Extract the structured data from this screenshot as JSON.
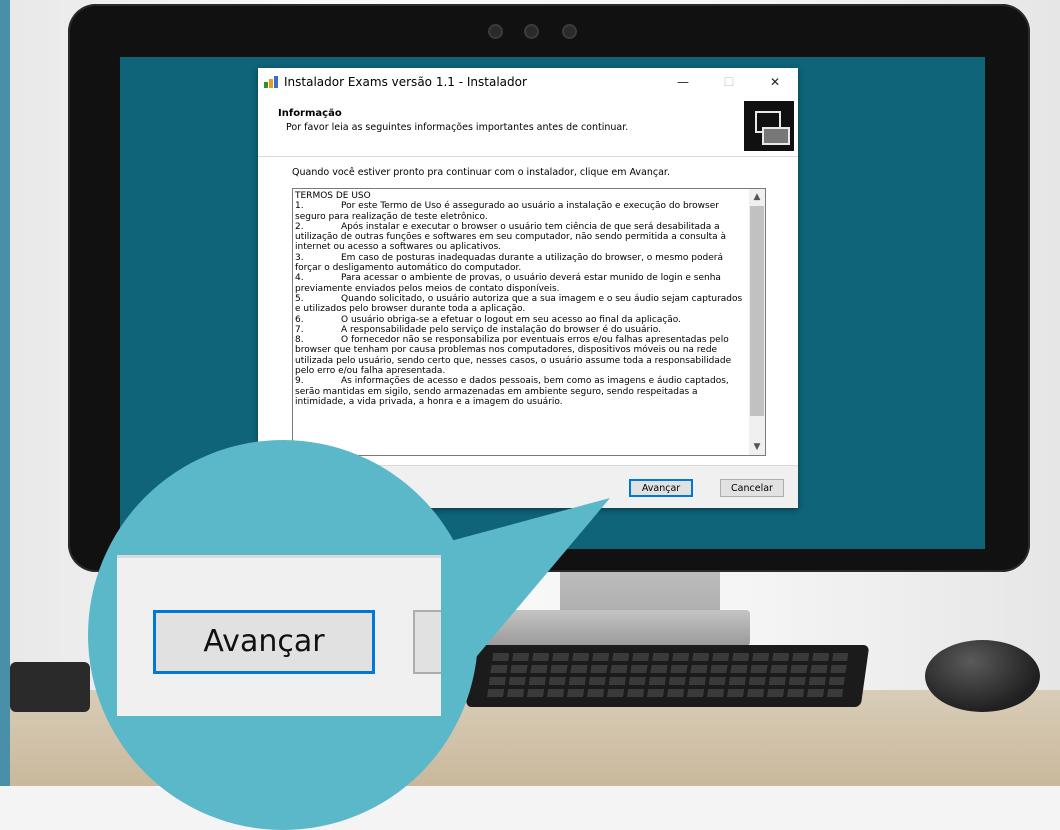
{
  "window": {
    "title": "Instalador Exams versão 1.1 - Instalador",
    "minimize_glyph": "—",
    "maximize_glyph": "☐",
    "close_glyph": "✕"
  },
  "header": {
    "title": "Informação",
    "subtitle": "Por favor leia as seguintes informações importantes antes de continuar."
  },
  "prompt": "Quando você estiver pronto pra continuar com o instalador, clique em Avançar.",
  "terms": [
    {
      "num": "",
      "text": "TERMOS DE USO"
    },
    {
      "num": "1.",
      "text": "Por este Termo de Uso é assegurado ao usuário a instalação e execução do browser"
    },
    {
      "num": "",
      "text": "seguro para realização de teste eletrônico."
    },
    {
      "num": "2.",
      "text": "Após instalar e executar o browser o usuário tem ciência de que será desabilitada a"
    },
    {
      "num": "",
      "text": "utilização de outras funções e softwares em seu computador, não sendo permitida a consulta à"
    },
    {
      "num": "",
      "text": "internet ou acesso a softwares ou aplicativos."
    },
    {
      "num": "3.",
      "text": "Em caso de posturas inadequadas durante a utilização do browser, o mesmo poderá"
    },
    {
      "num": "",
      "text": "forçar o desligamento automático do computador."
    },
    {
      "num": "4.",
      "text": "Para acessar o ambiente de provas, o usuário deverá estar munido de login e senha"
    },
    {
      "num": "",
      "text": "previamente enviados pelos meios de contato disponíveis."
    },
    {
      "num": "5.",
      "text": "Quando solicitado, o usuário autoriza que a sua imagem e o seu áudio sejam capturados"
    },
    {
      "num": "",
      "text": "e utilizados pelo browser durante toda a aplicação."
    },
    {
      "num": "6.",
      "text": "O usuário obriga-se a efetuar o logout em seu acesso ao final da aplicação."
    },
    {
      "num": "7.",
      "text": "A responsabilidade pelo serviço de instalação do browser é do usuário."
    },
    {
      "num": "8.",
      "text": "O fornecedor não se responsabiliza por eventuais erros e/ou falhas apresentadas pelo"
    },
    {
      "num": "",
      "text": "browser que tenham por causa problemas nos computadores, dispositivos móveis ou na rede"
    },
    {
      "num": "",
      "text": "utilizada pelo usuário, sendo certo que, nesses casos, o usuário assume toda a responsabilidade"
    },
    {
      "num": "",
      "text": "pelo erro e/ou falha apresentada."
    },
    {
      "num": "9.",
      "text": "As informações de acesso e dados pessoais, bem como as imagens e áudio captados,"
    },
    {
      "num": "",
      "text": "serão mantidas em sigilo, sendo armazenadas em ambiente seguro, sendo respeitadas a"
    },
    {
      "num": "",
      "text": "intimidade, a vida privada, a honra e a imagem do usuário."
    }
  ],
  "buttons": {
    "next": "Avançar",
    "cancel": "Cancelar"
  },
  "zoom": {
    "label": "Avançar"
  },
  "colors": {
    "screen": "#0f6479",
    "focus": "#0078d7",
    "magnifier": "#5bb8c9"
  }
}
